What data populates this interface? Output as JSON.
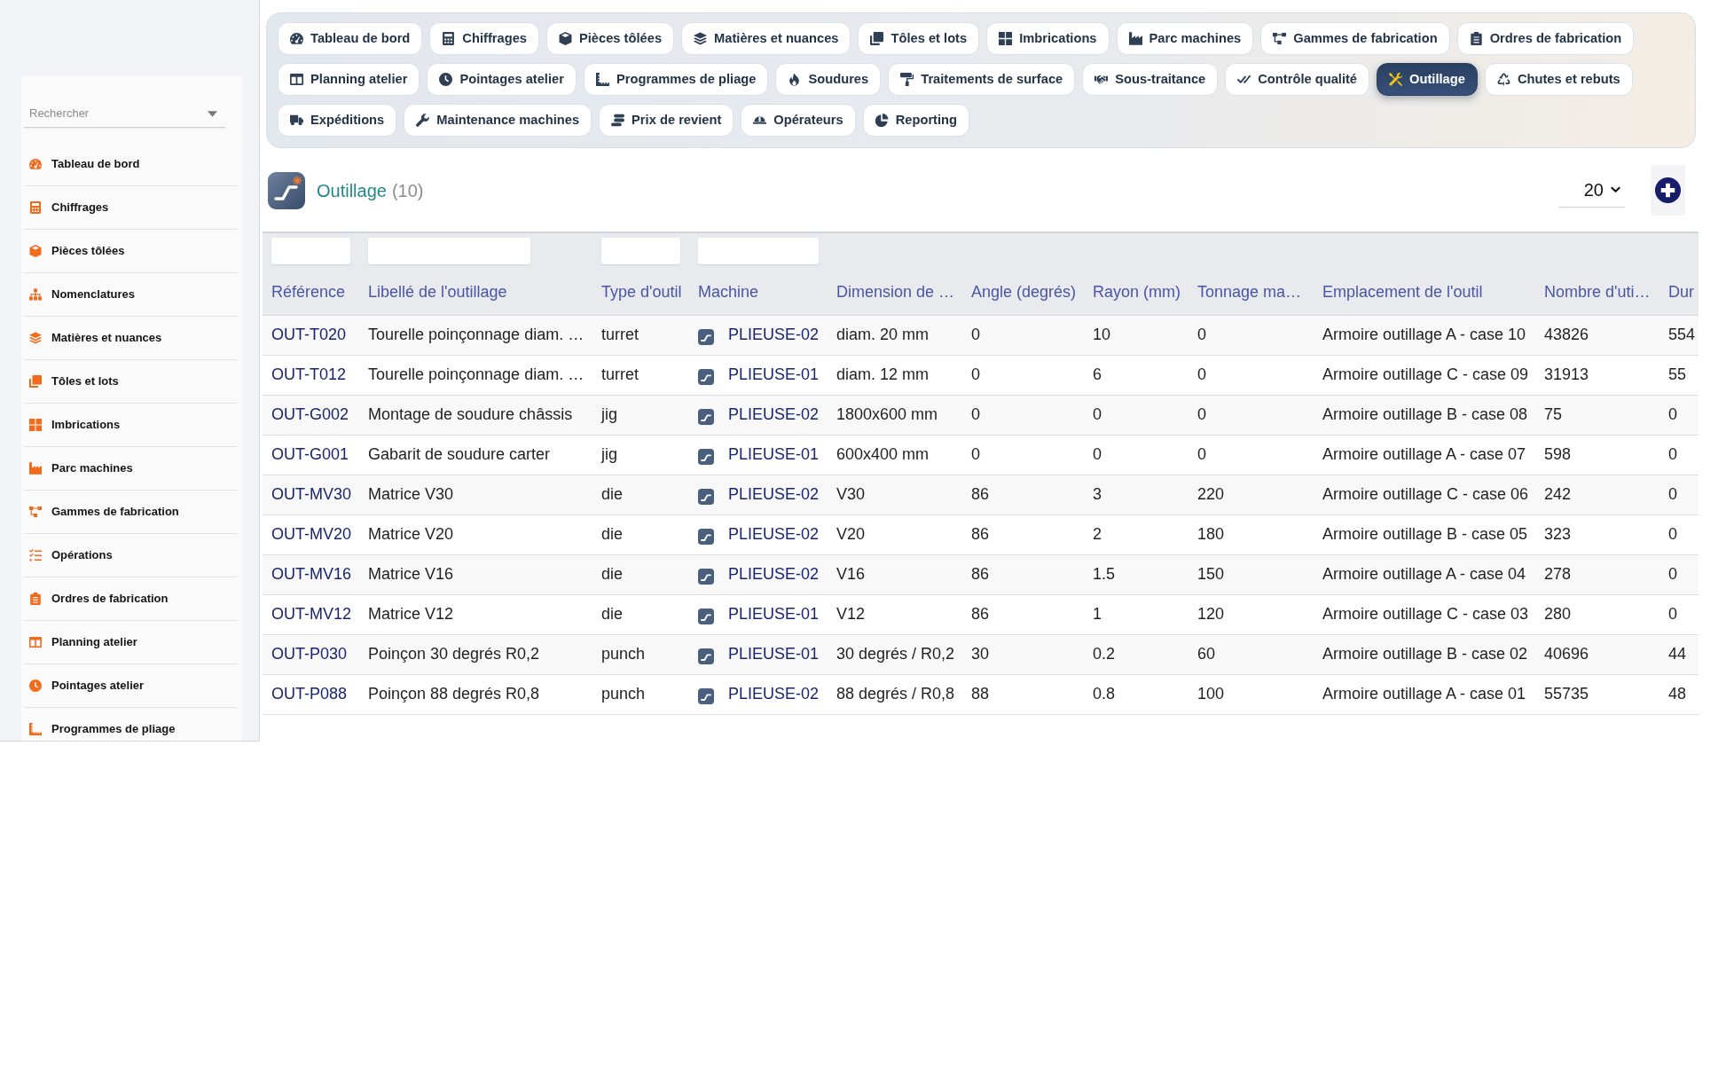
{
  "sidebar": {
    "search": {
      "placeholder": "Rechercher"
    },
    "items": [
      "Tableau de bord",
      "Chiffrages",
      "Pièces tôlées",
      "Nomenclatures",
      "Matières et nuances",
      "Tôles et lots",
      "Imbrications",
      "Parc machines",
      "Gammes de fabrication",
      "Opérations",
      "Ordres de fabrication",
      "Planning atelier",
      "Pointages atelier",
      "Programmes de pliage"
    ]
  },
  "tabs": [
    {
      "label": "Tableau de bord",
      "selected": false
    },
    {
      "label": "Chiffrages",
      "selected": false
    },
    {
      "label": "Pièces tôlées",
      "selected": false
    },
    {
      "label": "Matières et nuances",
      "selected": false
    },
    {
      "label": "Tôles et lots",
      "selected": false
    },
    {
      "label": "Imbrications",
      "selected": false
    },
    {
      "label": "Parc machines",
      "selected": false
    },
    {
      "label": "Gammes de fabrication",
      "selected": false
    },
    {
      "label": "Ordres de fabrication",
      "selected": false
    },
    {
      "label": "Planning atelier",
      "selected": false
    },
    {
      "label": "Pointages atelier",
      "selected": false
    },
    {
      "label": "Programmes de pliage",
      "selected": false
    },
    {
      "label": "Soudures",
      "selected": false
    },
    {
      "label": "Traitements de surface",
      "selected": false
    },
    {
      "label": "Sous-traitance",
      "selected": false
    },
    {
      "label": "Contrôle qualité",
      "selected": false
    },
    {
      "label": "Outillage",
      "selected": true
    },
    {
      "label": "Chutes et rebuts",
      "selected": false
    },
    {
      "label": "Expéditions",
      "selected": false
    },
    {
      "label": "Maintenance machines",
      "selected": false
    },
    {
      "label": "Prix de revient",
      "selected": false
    },
    {
      "label": "Opérateurs",
      "selected": false
    },
    {
      "label": "Reporting",
      "selected": false
    }
  ],
  "header": {
    "title": "Outillage",
    "count": "(10)",
    "page_size": "20"
  },
  "table": {
    "columns": [
      {
        "label": "Référence",
        "kind": "link",
        "filter": true
      },
      {
        "label": "Libellé de l'outillage",
        "kind": "text",
        "filter": true
      },
      {
        "label": "Type d'outil",
        "kind": "text",
        "filter": true
      },
      {
        "label": "Machine",
        "kind": "machine",
        "filter": true
      },
      {
        "label": "Dimension de …",
        "kind": "text",
        "filter": false
      },
      {
        "label": "Angle (degrés)",
        "kind": "text",
        "filter": false
      },
      {
        "label": "Rayon (mm)",
        "kind": "text",
        "filter": false
      },
      {
        "label": "Tonnage ma…",
        "kind": "text",
        "filter": false
      },
      {
        "label": "Emplacement de l'outil",
        "kind": "text",
        "filter": false
      },
      {
        "label": "Nombre d'uti…",
        "kind": "text",
        "filter": false
      },
      {
        "label": "Dur",
        "kind": "text",
        "filter": false
      }
    ],
    "rows": [
      [
        "OUT-T020",
        "Tourelle poinçonnage diam. …",
        "turret",
        "PLIEUSE-02",
        "diam. 20 mm",
        "0",
        "10",
        "0",
        "Armoire outillage A - case 10",
        "43826",
        "554"
      ],
      [
        "OUT-T012",
        "Tourelle poinçonnage diam. …",
        "turret",
        "PLIEUSE-01",
        "diam. 12 mm",
        "0",
        "6",
        "0",
        "Armoire outillage C - case 09",
        "31913",
        "55"
      ],
      [
        "OUT-G002",
        "Montage de soudure châssis",
        "jig",
        "PLIEUSE-02",
        "1800x600 mm",
        "0",
        "0",
        "0",
        "Armoire outillage B - case 08",
        "75",
        "0"
      ],
      [
        "OUT-G001",
        "Gabarit de soudure carter",
        "jig",
        "PLIEUSE-01",
        "600x400 mm",
        "0",
        "0",
        "0",
        "Armoire outillage A - case 07",
        "598",
        "0"
      ],
      [
        "OUT-MV30",
        "Matrice V30",
        "die",
        "PLIEUSE-02",
        "V30",
        "86",
        "3",
        "220",
        "Armoire outillage C - case 06",
        "242",
        "0"
      ],
      [
        "OUT-MV20",
        "Matrice V20",
        "die",
        "PLIEUSE-02",
        "V20",
        "86",
        "2",
        "180",
        "Armoire outillage B - case 05",
        "323",
        "0"
      ],
      [
        "OUT-MV16",
        "Matrice V16",
        "die",
        "PLIEUSE-02",
        "V16",
        "86",
        "1.5",
        "150",
        "Armoire outillage A - case 04",
        "278",
        "0"
      ],
      [
        "OUT-MV12",
        "Matrice V12",
        "die",
        "PLIEUSE-01",
        "V12",
        "86",
        "1",
        "120",
        "Armoire outillage C - case 03",
        "280",
        "0"
      ],
      [
        "OUT-P030",
        "Poinçon 30 degrés R0,2",
        "punch",
        "PLIEUSE-01",
        "30 degrés / R0,2",
        "30",
        "0.2",
        "60",
        "Armoire outillage B - case 02",
        "40696",
        "44"
      ],
      [
        "OUT-P088",
        "Poinçon 88 degrés R0,8",
        "punch",
        "PLIEUSE-02",
        "88 degrés / R0,8",
        "88",
        "0.8",
        "100",
        "Armoire outillage A - case 01",
        "55735",
        "48"
      ]
    ]
  }
}
